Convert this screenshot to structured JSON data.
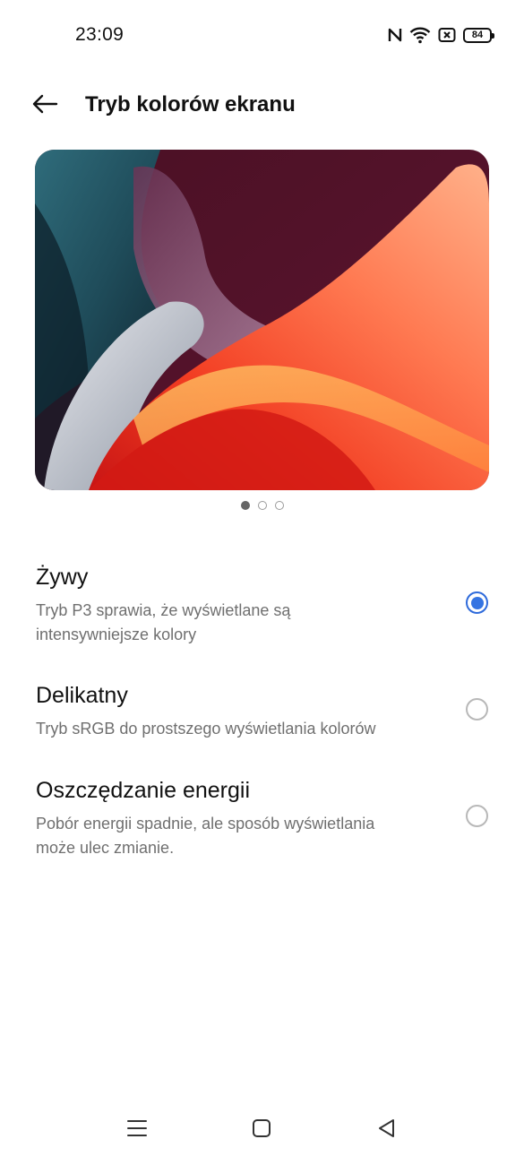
{
  "status_bar": {
    "time": "23:09",
    "icons": [
      "nfc-icon",
      "wifi-icon",
      "no-sim-icon",
      "battery-icon"
    ],
    "battery_level": "84"
  },
  "header": {
    "back_icon": "arrow-left-icon",
    "title": "Tryb kolorów ekranu"
  },
  "preview": {
    "image": "abstract-wave-wallpaper",
    "page_indicator": {
      "count": 3,
      "active_index": 0
    }
  },
  "options": [
    {
      "title": "Żywy",
      "description_line1": "Tryb P3 sprawia, że wyświetlane są",
      "description_line2": "intensywniejsze kolory",
      "selected": true
    },
    {
      "title": "Delikatny",
      "description_line1": "Tryb sRGB do prostszego wyświetlania kolorów",
      "description_line2": "",
      "selected": false
    },
    {
      "title": "Oszczędzanie energii",
      "description_line1": "Pobór energii spadnie, ale sposób wyświetlania",
      "description_line2": "może ulec zmianie.",
      "selected": false
    }
  ],
  "nav_bar": {
    "icons": [
      "menu-icon",
      "home-icon",
      "back-triangle-icon"
    ]
  },
  "colors": {
    "accent": "#3574e2",
    "text_primary": "#111111",
    "text_secondary": "#6f6f6f"
  }
}
